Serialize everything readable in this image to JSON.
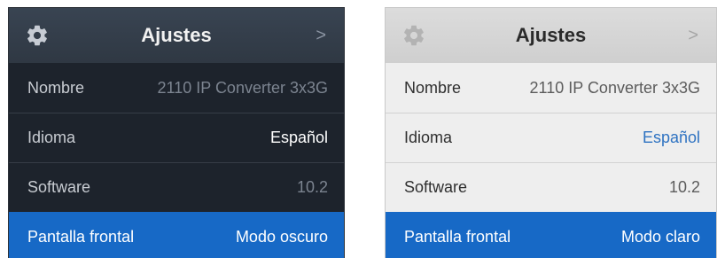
{
  "panels": [
    {
      "theme": "dark",
      "header": {
        "title": "Ajustes",
        "chevron": ">"
      },
      "icons": {
        "left": "gear-icon",
        "right": "chevron-right-icon"
      },
      "rows": [
        {
          "label": "Nombre",
          "value": "2110 IP Converter 3x3G"
        },
        {
          "label": "Idioma",
          "value": "Español"
        },
        {
          "label": "Software",
          "value": "10.2"
        },
        {
          "label": "Pantalla frontal",
          "value": "Modo oscuro"
        }
      ],
      "colors": {
        "header": "#333d4a",
        "row": "#1d232c",
        "selected": "#1769c6"
      }
    },
    {
      "theme": "light",
      "header": {
        "title": "Ajustes",
        "chevron": ">"
      },
      "icons": {
        "left": "gear-icon",
        "right": "chevron-right-icon"
      },
      "rows": [
        {
          "label": "Nombre",
          "value": "2110 IP Converter 3x3G"
        },
        {
          "label": "Idioma",
          "value": "Español"
        },
        {
          "label": "Software",
          "value": "10.2"
        },
        {
          "label": "Pantalla frontal",
          "value": "Modo claro"
        }
      ],
      "colors": {
        "header": "#d6d6d6",
        "row": "#eeeeee",
        "selected": "#1769c6",
        "accent": "#2f73c2"
      }
    }
  ]
}
